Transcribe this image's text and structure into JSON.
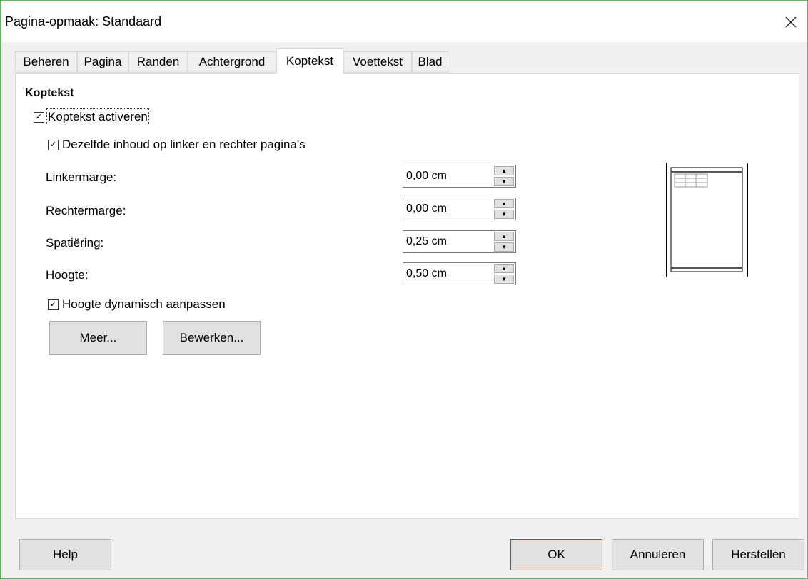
{
  "window": {
    "title": "Pagina-opmaak: Standaard"
  },
  "tabs": [
    {
      "label": "Beheren",
      "active": false
    },
    {
      "label": "Pagina",
      "active": false
    },
    {
      "label": "Randen",
      "active": false
    },
    {
      "label": "Achtergrond",
      "active": false
    },
    {
      "label": "Koptekst",
      "active": true
    },
    {
      "label": "Voettekst",
      "active": false
    },
    {
      "label": "Blad",
      "active": false
    }
  ],
  "section": {
    "heading": "Koptekst",
    "enable_header": {
      "label": "Koptekst activeren",
      "checked": true
    },
    "same_content": {
      "label": "Dezelfde inhoud op linker en rechter pagina's",
      "checked": true
    },
    "fields": [
      {
        "label": "Linkermarge:",
        "value": "0,00 cm"
      },
      {
        "label": "Rechtermarge:",
        "value": "0,00 cm"
      },
      {
        "label": "Spatiëring:",
        "value": "0,25 cm"
      },
      {
        "label": "Hoogte:",
        "value": "0,50 cm"
      }
    ],
    "autofit_height": {
      "label": "Hoogte dynamisch aanpassen",
      "checked": true
    },
    "more_label": "Meer...",
    "edit_label": "Bewerken..."
  },
  "footer": {
    "help_label": "Help",
    "ok_label": "OK",
    "cancel_label": "Annuleren",
    "reset_label": "Herstellen"
  },
  "colors": {
    "accent": "#0078d7",
    "window_border": "#5fb05f",
    "background": "#f0f0f0"
  }
}
